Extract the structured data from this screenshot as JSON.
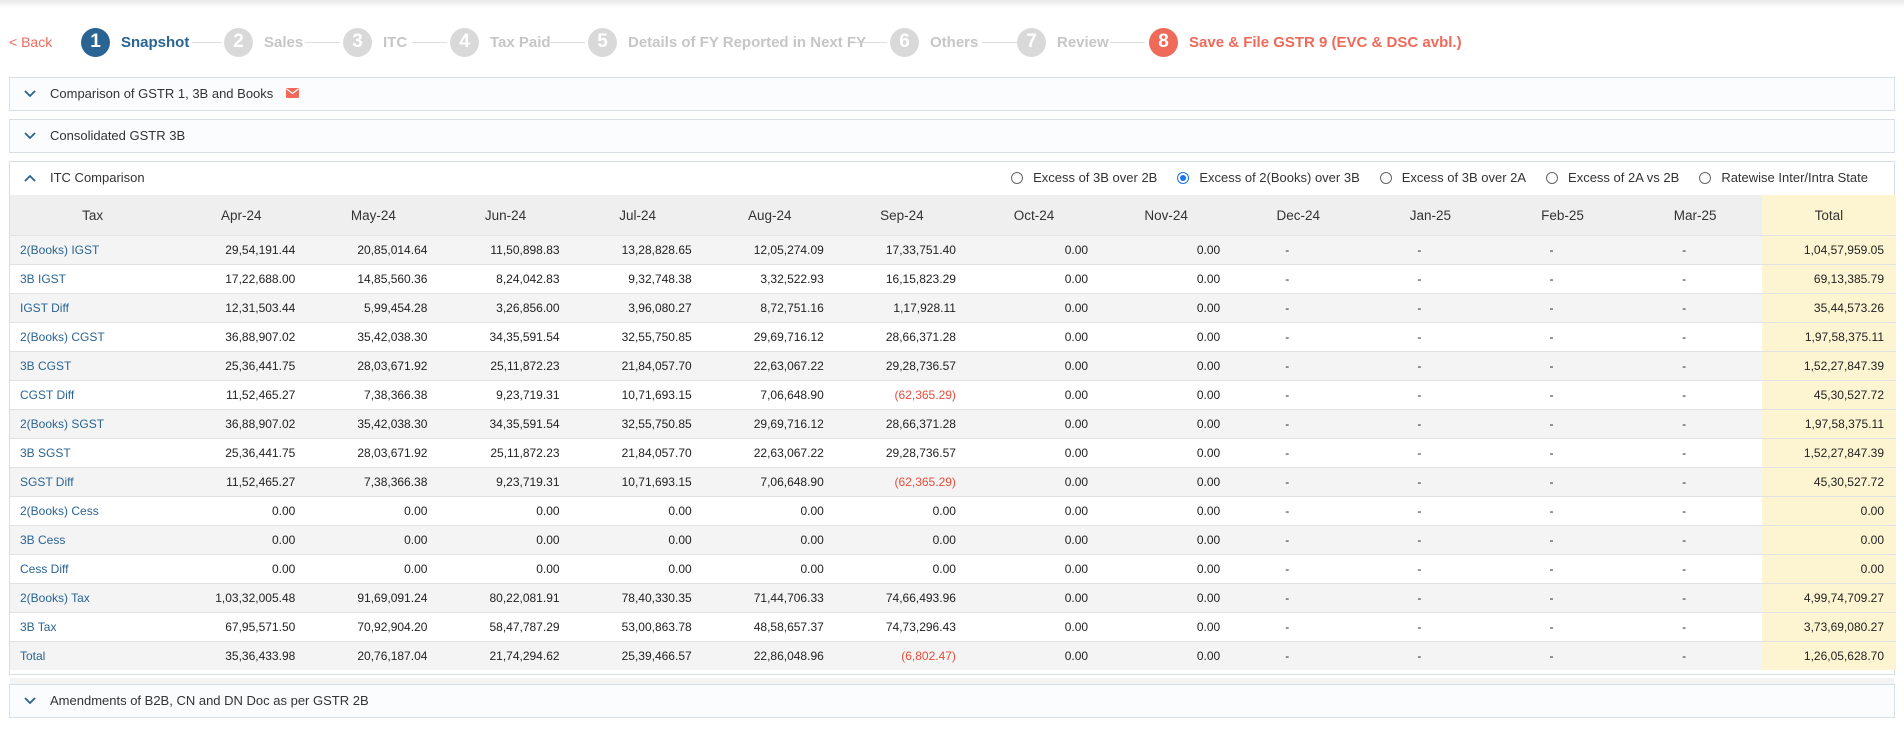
{
  "nav": {
    "back_label": "< Back",
    "steps": [
      {
        "num": "1",
        "label": "Snapshot"
      },
      {
        "num": "2",
        "label": "Sales"
      },
      {
        "num": "3",
        "label": "ITC"
      },
      {
        "num": "4",
        "label": "Tax Paid"
      },
      {
        "num": "5",
        "label": "Details of FY Reported in Next FY"
      },
      {
        "num": "6",
        "label": "Others"
      },
      {
        "num": "7",
        "label": "Review"
      },
      {
        "num": "8",
        "label": "Save & File GSTR 9 (EVC & DSC avbl.)"
      }
    ]
  },
  "panels": {
    "comparison": {
      "title": "Comparison of GSTR 1, 3B and Books"
    },
    "consolidated": {
      "title": "Consolidated GSTR 3B"
    },
    "itc": {
      "title": "ITC Comparison"
    },
    "amendments": {
      "title": "Amendments of B2B, CN and DN Doc as per GSTR 2B"
    }
  },
  "radios": [
    {
      "label": "Excess of 3B over 2B",
      "checked": false
    },
    {
      "label": "Excess of 2(Books) over 3B",
      "checked": true
    },
    {
      "label": "Excess of 3B over 2A",
      "checked": false
    },
    {
      "label": "Excess of 2A vs 2B",
      "checked": false
    },
    {
      "label": "Ratewise Inter/Intra State",
      "checked": false
    }
  ],
  "colors": {
    "accent": "#2a6493",
    "save": "#f06a5a",
    "negative": "#e84c3d",
    "total_bg": "#fdf5d2"
  },
  "table": {
    "headers": [
      "Tax",
      "Apr-24",
      "May-24",
      "Jun-24",
      "Jul-24",
      "Aug-24",
      "Sep-24",
      "Oct-24",
      "Nov-24",
      "Dec-24",
      "Jan-25",
      "Feb-25",
      "Mar-25",
      "Total"
    ],
    "rows": [
      {
        "label": "2(Books) IGST",
        "cells": [
          "29,54,191.44",
          "20,85,014.64",
          "11,50,898.83",
          "13,28,828.65",
          "12,05,274.09",
          "17,33,751.40",
          "0.00",
          "0.00",
          "-",
          "-",
          "-",
          "-",
          "1,04,57,959.05"
        ]
      },
      {
        "label": "3B IGST",
        "cells": [
          "17,22,688.00",
          "14,85,560.36",
          "8,24,042.83",
          "9,32,748.38",
          "3,32,522.93",
          "16,15,823.29",
          "0.00",
          "0.00",
          "-",
          "-",
          "-",
          "-",
          "69,13,385.79"
        ]
      },
      {
        "label": "IGST Diff",
        "cells": [
          "12,31,503.44",
          "5,99,454.28",
          "3,26,856.00",
          "3,96,080.27",
          "8,72,751.16",
          "1,17,928.11",
          "0.00",
          "0.00",
          "-",
          "-",
          "-",
          "-",
          "35,44,573.26"
        ]
      },
      {
        "label": "2(Books) CGST",
        "cells": [
          "36,88,907.02",
          "35,42,038.30",
          "34,35,591.54",
          "32,55,750.85",
          "29,69,716.12",
          "28,66,371.28",
          "0.00",
          "0.00",
          "-",
          "-",
          "-",
          "-",
          "1,97,58,375.11"
        ]
      },
      {
        "label": "3B CGST",
        "cells": [
          "25,36,441.75",
          "28,03,671.92",
          "25,11,872.23",
          "21,84,057.70",
          "22,63,067.22",
          "29,28,736.57",
          "0.00",
          "0.00",
          "-",
          "-",
          "-",
          "-",
          "1,52,27,847.39"
        ]
      },
      {
        "label": "CGST Diff",
        "cells": [
          "11,52,465.27",
          "7,38,366.38",
          "9,23,719.31",
          "10,71,693.15",
          "7,06,648.90",
          "(62,365.29)",
          "0.00",
          "0.00",
          "-",
          "-",
          "-",
          "-",
          "45,30,527.72"
        ]
      },
      {
        "label": "2(Books) SGST",
        "cells": [
          "36,88,907.02",
          "35,42,038.30",
          "34,35,591.54",
          "32,55,750.85",
          "29,69,716.12",
          "28,66,371.28",
          "0.00",
          "0.00",
          "-",
          "-",
          "-",
          "-",
          "1,97,58,375.11"
        ]
      },
      {
        "label": "3B SGST",
        "cells": [
          "25,36,441.75",
          "28,03,671.92",
          "25,11,872.23",
          "21,84,057.70",
          "22,63,067.22",
          "29,28,736.57",
          "0.00",
          "0.00",
          "-",
          "-",
          "-",
          "-",
          "1,52,27,847.39"
        ]
      },
      {
        "label": "SGST Diff",
        "cells": [
          "11,52,465.27",
          "7,38,366.38",
          "9,23,719.31",
          "10,71,693.15",
          "7,06,648.90",
          "(62,365.29)",
          "0.00",
          "0.00",
          "-",
          "-",
          "-",
          "-",
          "45,30,527.72"
        ]
      },
      {
        "label": "2(Books) Cess",
        "cells": [
          "0.00",
          "0.00",
          "0.00",
          "0.00",
          "0.00",
          "0.00",
          "0.00",
          "0.00",
          "-",
          "-",
          "-",
          "-",
          "0.00"
        ]
      },
      {
        "label": "3B Cess",
        "cells": [
          "0.00",
          "0.00",
          "0.00",
          "0.00",
          "0.00",
          "0.00",
          "0.00",
          "0.00",
          "-",
          "-",
          "-",
          "-",
          "0.00"
        ]
      },
      {
        "label": "Cess Diff",
        "cells": [
          "0.00",
          "0.00",
          "0.00",
          "0.00",
          "0.00",
          "0.00",
          "0.00",
          "0.00",
          "-",
          "-",
          "-",
          "-",
          "0.00"
        ]
      },
      {
        "label": "2(Books) Tax",
        "cells": [
          "1,03,32,005.48",
          "91,69,091.24",
          "80,22,081.91",
          "78,40,330.35",
          "71,44,706.33",
          "74,66,493.96",
          "0.00",
          "0.00",
          "-",
          "-",
          "-",
          "-",
          "4,99,74,709.27"
        ]
      },
      {
        "label": "3B Tax",
        "cells": [
          "67,95,571.50",
          "70,92,904.20",
          "58,47,787.29",
          "53,00,863.78",
          "48,58,657.37",
          "74,73,296.43",
          "0.00",
          "0.00",
          "-",
          "-",
          "-",
          "-",
          "3,73,69,080.27"
        ]
      },
      {
        "label": "Total",
        "cells": [
          "35,36,433.98",
          "20,76,187.04",
          "21,74,294.62",
          "25,39,466.57",
          "22,86,048.96",
          "(6,802.47)",
          "0.00",
          "0.00",
          "-",
          "-",
          "-",
          "-",
          "1,26,05,628.70"
        ]
      }
    ]
  }
}
